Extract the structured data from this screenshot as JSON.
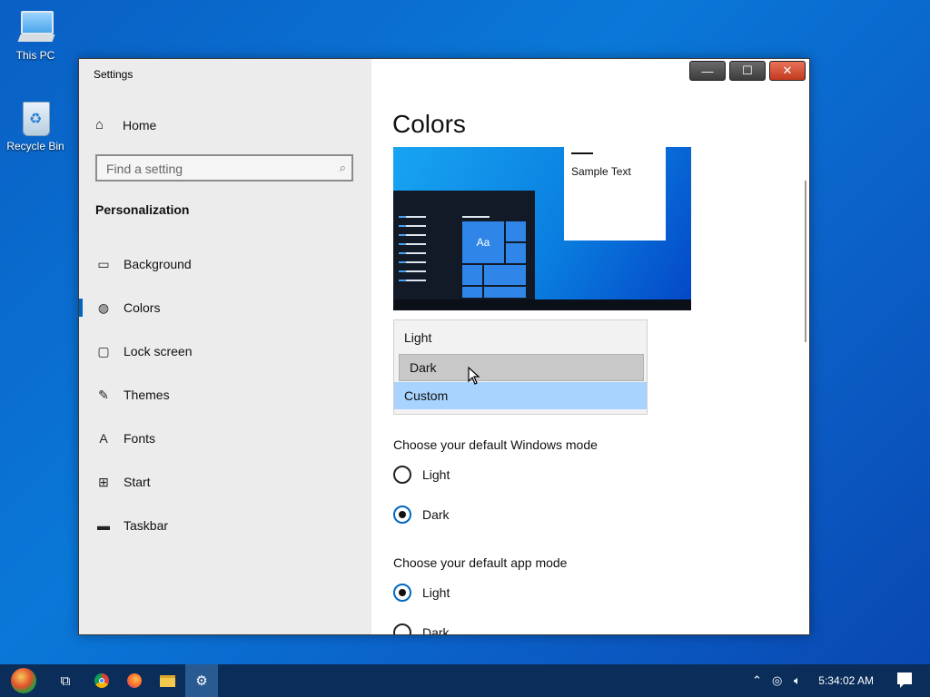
{
  "desktop": {
    "icons": [
      {
        "label": "This PC",
        "icon": "computer-icon"
      },
      {
        "label": "Recycle Bin",
        "icon": "recycle-bin-icon"
      }
    ]
  },
  "window": {
    "title": "Settings",
    "buttons": {
      "minimize": "—",
      "maximize": "☐",
      "close": "✕"
    }
  },
  "sidebar": {
    "home_label": "Home",
    "search_placeholder": "Find a setting",
    "section_title": "Personalization",
    "items": [
      {
        "label": "Background",
        "icon": "picture-icon",
        "glyph": "▭"
      },
      {
        "label": "Colors",
        "icon": "palette-icon",
        "glyph": "◍",
        "active": true
      },
      {
        "label": "Lock screen",
        "icon": "lock-screen-icon",
        "glyph": "▢"
      },
      {
        "label": "Themes",
        "icon": "brush-icon",
        "glyph": "✎"
      },
      {
        "label": "Fonts",
        "icon": "font-icon",
        "glyph": "A"
      },
      {
        "label": "Start",
        "icon": "start-icon",
        "glyph": "⊞"
      },
      {
        "label": "Taskbar",
        "icon": "taskbar-icon",
        "glyph": "▬"
      }
    ]
  },
  "main": {
    "title": "Colors",
    "preview": {
      "sample_text": "Sample Text",
      "tile_text": "Aa"
    },
    "color_dropdown": {
      "options": [
        "Light",
        "Dark",
        "Custom"
      ],
      "selected": "Custom",
      "hovered": "Dark"
    },
    "windows_mode": {
      "label": "Choose your default Windows mode",
      "options": [
        "Light",
        "Dark"
      ],
      "selected": "Dark"
    },
    "app_mode": {
      "label": "Choose your default app mode",
      "options": [
        "Light",
        "Dark"
      ],
      "selected": "Light"
    }
  },
  "taskbar": {
    "clock": "5:34:02 AM",
    "apps": [
      "start-orb-icon",
      "task-view-icon",
      "chrome-icon",
      "firefox-icon",
      "file-explorer-icon",
      "settings-icon"
    ]
  },
  "colors": {
    "accent": "#0067c0",
    "selection": "#a8d3ff",
    "taskbar": "#0b2d5a"
  }
}
